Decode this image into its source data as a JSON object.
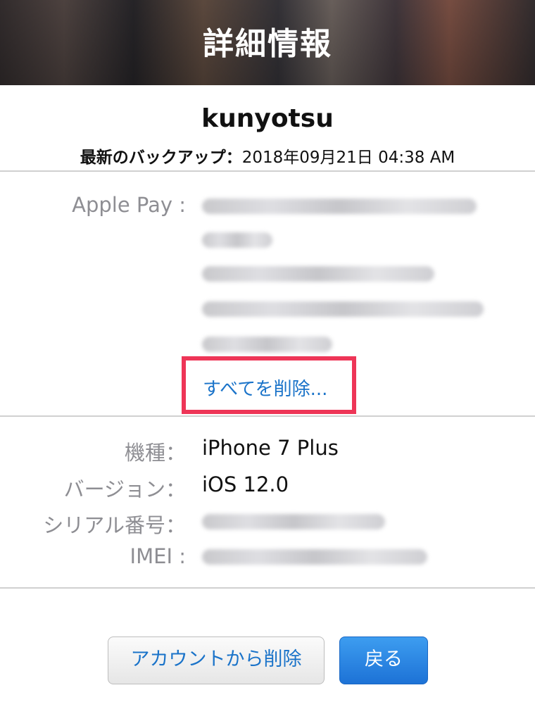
{
  "header": {
    "title": "詳細情報"
  },
  "device": {
    "account_name": "kunyotsu",
    "backup_label": "最新のバックアップ：",
    "backup_value": "2018年09月21日 04:38 AM"
  },
  "apple_pay": {
    "label": "Apple Pay :",
    "delete_all_label": "すべてを削除..."
  },
  "info": {
    "model_label": "機種：",
    "model_value": "iPhone 7 Plus",
    "version_label": "バージョン：",
    "version_value": "iOS 12.0",
    "serial_label": "シリアル番号：",
    "imei_label": "IMEI :"
  },
  "buttons": {
    "remove_label": "アカウントから削除",
    "back_label": "戻る"
  },
  "colors": {
    "link": "#1a73c9",
    "highlight_border": "#ee3557",
    "primary_button": "#2a86e4"
  }
}
